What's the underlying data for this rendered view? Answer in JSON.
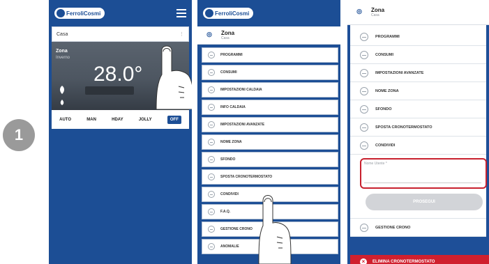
{
  "step_number": "1",
  "phone1": {
    "logo_text": "FerroliCosmi",
    "home_name": "Casa",
    "zone_label": "Zona",
    "zone_sub": "Inverno",
    "temperature": "28.0°",
    "modes": [
      "AUTO",
      "MAN",
      "HDAY",
      "JOLLY"
    ],
    "mode_active": "OFF"
  },
  "phone2": {
    "logo_text": "FerroliCosmi",
    "zone_title": "Zona",
    "zone_sub": "Casa",
    "menu": [
      "PROGRAMMI",
      "CONSUMI",
      "IMPOSTAZIONI CALDAIA",
      "INFO CALDAIA",
      "IMPOSTAZIONI AVANZATE",
      "NOME ZONA",
      "SFONDO",
      "SPOSTA CRONOTERMOSTATO",
      "CONDIVIDI",
      "F.A.Q.",
      "GESTIONE CRONO",
      "ANOMALIE"
    ]
  },
  "phone3": {
    "zone_title": "Zona",
    "zone_sub": "Casa",
    "menu_top": [
      "PROGRAMMI",
      "CONSUMI",
      "IMPOSTAZIONI AVANZATE",
      "NOME ZONA",
      "SFONDO",
      "SPOSTA CRONOTERMOSTATO",
      "CONDIVIDI"
    ],
    "field_label": "Nome Utente *",
    "submit_label": "PROSEGUI",
    "menu_bottom": "GESTIONE CRONO",
    "delete_label": "ELIMINA CRONOTERMOSTATO"
  },
  "colors": {
    "brand_blue": "#1c4e95",
    "highlight_red": "#c8202e",
    "badge_gray": "#9a9a9a"
  }
}
